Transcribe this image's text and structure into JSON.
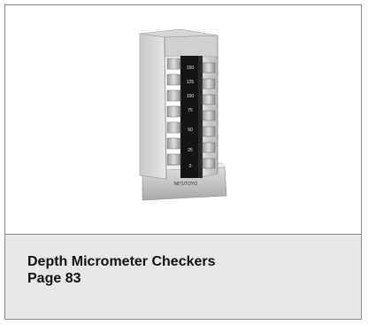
{
  "caption": {
    "title": "Depth Micrometer Checkers",
    "page": "Page 83"
  },
  "product_image": {
    "icon": "depth-micrometer-checker-image",
    "step_labels": [
      "150",
      "125",
      "100",
      "75",
      "50",
      "25",
      "0"
    ],
    "brand_mark": "MITUTOYO"
  }
}
